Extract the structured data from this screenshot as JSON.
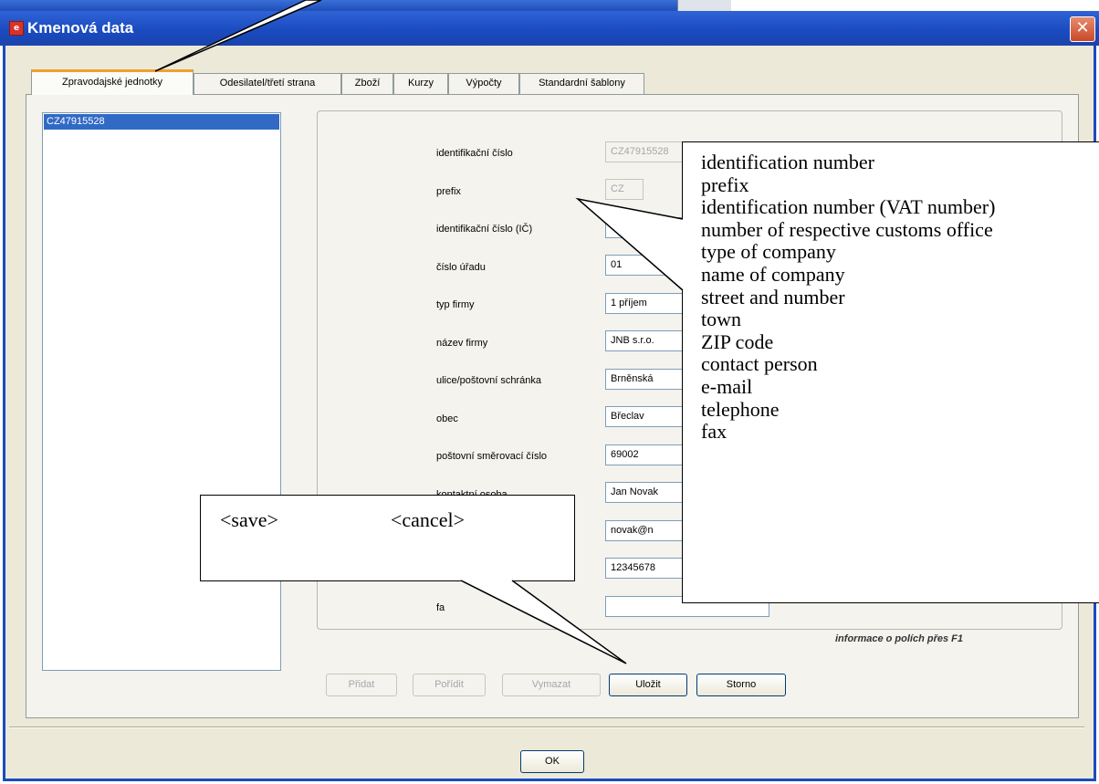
{
  "window": {
    "title": "Kmenová data",
    "close_glyph": "✕",
    "app_icon": "app-icon"
  },
  "tabs": [
    {
      "label": "Zpravodajské jednotky",
      "active": true
    },
    {
      "label": "Odesilatel/třetí strana",
      "active": false
    },
    {
      "label": "Zboží",
      "active": false
    },
    {
      "label": "Kurzy",
      "active": false
    },
    {
      "label": "Výpočty",
      "active": false
    },
    {
      "label": "Standardní šablony",
      "active": false
    }
  ],
  "list": {
    "items": [
      "CZ47915528"
    ]
  },
  "form": {
    "fields": [
      {
        "label": "identifikační číslo",
        "value": "CZ47915528"
      },
      {
        "label": "prefix",
        "value": "CZ"
      },
      {
        "label": "identifikační číslo (IČ)",
        "value": ""
      },
      {
        "label": "číslo úřadu",
        "value": "01"
      },
      {
        "label": "typ firmy",
        "value": "1 příjem"
      },
      {
        "label": "název firmy",
        "value": "JNB s.r.o."
      },
      {
        "label": "ulice/poštovní schránka",
        "value": "Brněnská"
      },
      {
        "label": "obec",
        "value": "Břeclav"
      },
      {
        "label": "poštovní směrovací číslo",
        "value": "69002"
      },
      {
        "label": "kontaktní osoba",
        "value": "Jan Novak"
      },
      {
        "label": "",
        "value": "novak@n"
      },
      {
        "label": "",
        "value": "12345678"
      },
      {
        "label": "fa",
        "value": ""
      }
    ],
    "hint": "informace o polích přes F1"
  },
  "buttons": {
    "add": "Přidat",
    "order": "Pořídit",
    "delete": "Vymazat",
    "save": "Uložit",
    "cancel": "Storno",
    "ok": "OK"
  },
  "annotations": {
    "english_labels": [
      "identification number",
      "prefix",
      "identification number (VAT number)",
      "number of respective customs office",
      "type of company",
      "name of company",
      "street and number",
      "town",
      "ZIP code",
      "contact person",
      "e-mail",
      "telephone",
      "fax"
    ],
    "save_note": "<save>",
    "cancel_note": "<cancel>"
  },
  "colors": {
    "titlebar": "#1b4bc0",
    "selection": "#316ac5",
    "active_tab_accent": "#f0a030",
    "close_button": "#c8492b"
  }
}
